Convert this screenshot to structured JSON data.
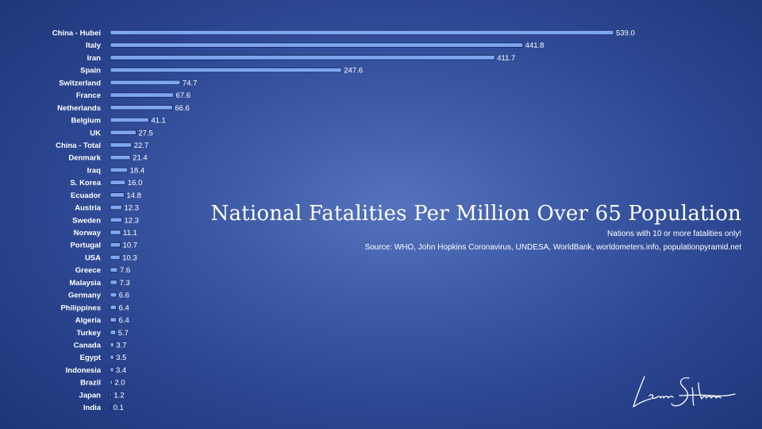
{
  "chart_data": {
    "type": "bar",
    "orientation": "horizontal",
    "title": "National Fatalities Per Million Over 65 Population",
    "subtitle": "Nations with 10 or more fatalities only!",
    "source": "Source: WHO, John Hopkins Coronavirus, UNDESA, WorldBank, worldometers.info, populationpyramid.net",
    "categories": [
      "China - Hubei",
      "Italy",
      "Iran",
      "Spain",
      "Switzerland",
      "France",
      "Netherlands",
      "Belgium",
      "UK",
      "China - Total",
      "Denmark",
      "Iraq",
      "S. Korea",
      "Ecuador",
      "Austria",
      "Sweden",
      "Norway",
      "Portugal",
      "USA",
      "Greece",
      "Malaysia",
      "Germany",
      "Philippines",
      "Algeria",
      "Turkey",
      "Canada",
      "Egypt",
      "Indonesia",
      "Brazil",
      "Japan",
      "India"
    ],
    "values": [
      539.0,
      441.8,
      411.7,
      247.6,
      74.7,
      67.6,
      66.6,
      41.1,
      27.5,
      22.7,
      21.4,
      18.4,
      16.0,
      14.8,
      12.3,
      12.3,
      11.1,
      10.7,
      10.3,
      7.6,
      7.3,
      6.6,
      6.4,
      6.4,
      5.7,
      3.7,
      3.5,
      3.4,
      2.0,
      1.2,
      0.1
    ],
    "value_labels": [
      "539.0",
      "441.8",
      "411.7",
      "247.6",
      "74.7",
      "67.6",
      "66.6",
      "41.1",
      "27.5",
      "22.7",
      "21.4",
      "18.4",
      "16.0",
      "14.8",
      "12.3",
      "12.3",
      "11.1",
      "10.7",
      "10.3",
      "7.6",
      "7.3",
      "6.6",
      "6.4",
      "6.4",
      "5.7",
      "3.7",
      "3.5",
      "3.4",
      "2.0",
      "1.2",
      "0.1"
    ],
    "xlim": [
      0,
      539.0
    ],
    "grid": false,
    "legend": "none",
    "colors": {
      "bar": "#7fa6f0",
      "bar_outline": "#12235a",
      "text": "#ffffff",
      "background": "#2b4590"
    }
  },
  "signature": "Leon Shivamber"
}
